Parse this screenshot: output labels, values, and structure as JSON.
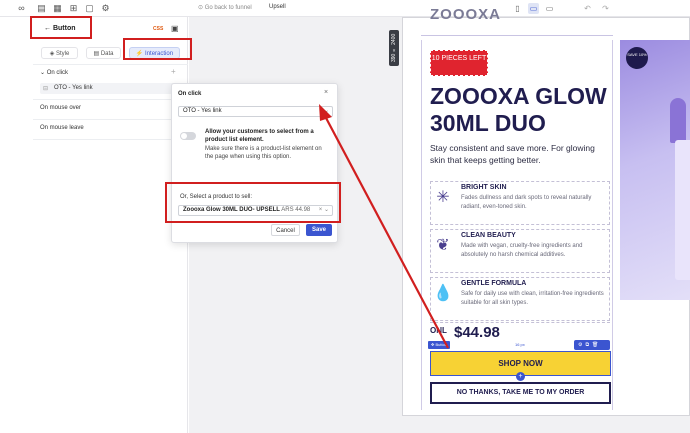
{
  "topbar": {
    "back_link": "Go back to funnel",
    "page_name": "Upsell"
  },
  "panel": {
    "back_label": "Button",
    "css_badge": "CSS",
    "tabs": [
      {
        "label": "Style"
      },
      {
        "label": "Data"
      },
      {
        "label": "Interaction"
      }
    ],
    "on_click_label": "On click",
    "action_label": "OTO - Yes link",
    "on_mouse_over_label": "On mouse over",
    "on_mouse_leave_label": "On mouse leave"
  },
  "popup": {
    "title": "On click",
    "close": "×",
    "action_select_value": "OTO - Yes link",
    "allow_title": "Allow your customers to select from a product list element.",
    "allow_sub": "Make sure there is a product-list element on the page when using this option.",
    "or_label": "Or, Select a product to sell:",
    "product_select_value": "Zoooxa Glow 30ML DUO- UPSELL",
    "product_price": "ARS 44.98",
    "cancel_label": "Cancel",
    "save_label": "Save"
  },
  "canvas": {
    "size_tag": "390 × 2400"
  },
  "landing": {
    "logo": "ZOOOXA",
    "pieces_badge": "10 PIECES LEFT",
    "save_badge": "SAVE 10%",
    "title": "ZOOOXA GLOW 30ML DUO",
    "subtitle": "Stay consistent and save more. For glowing skin that keeps getting better.",
    "features": [
      {
        "icon": "sparkle-icon",
        "title": "BRIGHT SKIN",
        "desc": "Fades dullness and dark spots to reveal naturally radiant, even-toned skin."
      },
      {
        "icon": "leaf-icon",
        "title": "CLEAN BEAUTY",
        "desc": "Made with vegan, cruelty-free ingredients and absolutely no harsh chemical additives."
      },
      {
        "icon": "drop-icon",
        "title": "GENTLE FORMULA",
        "desc": "Safe for daily use with clean, irritation-free ingredients suitable for all skin types."
      }
    ],
    "only_label": "ONL",
    "price": "$44.98",
    "selected_tag": "Button",
    "px_label": "16 px",
    "shop_label": "SHOP NOW",
    "no_thanks_label": "NO THANKS, TAKE ME TO MY ORDER"
  },
  "colors": {
    "annotation_red": "#d11f1f",
    "accent_blue": "#3b55d0",
    "cta_yellow": "#f7d234",
    "brand_navy": "#201d4f"
  }
}
